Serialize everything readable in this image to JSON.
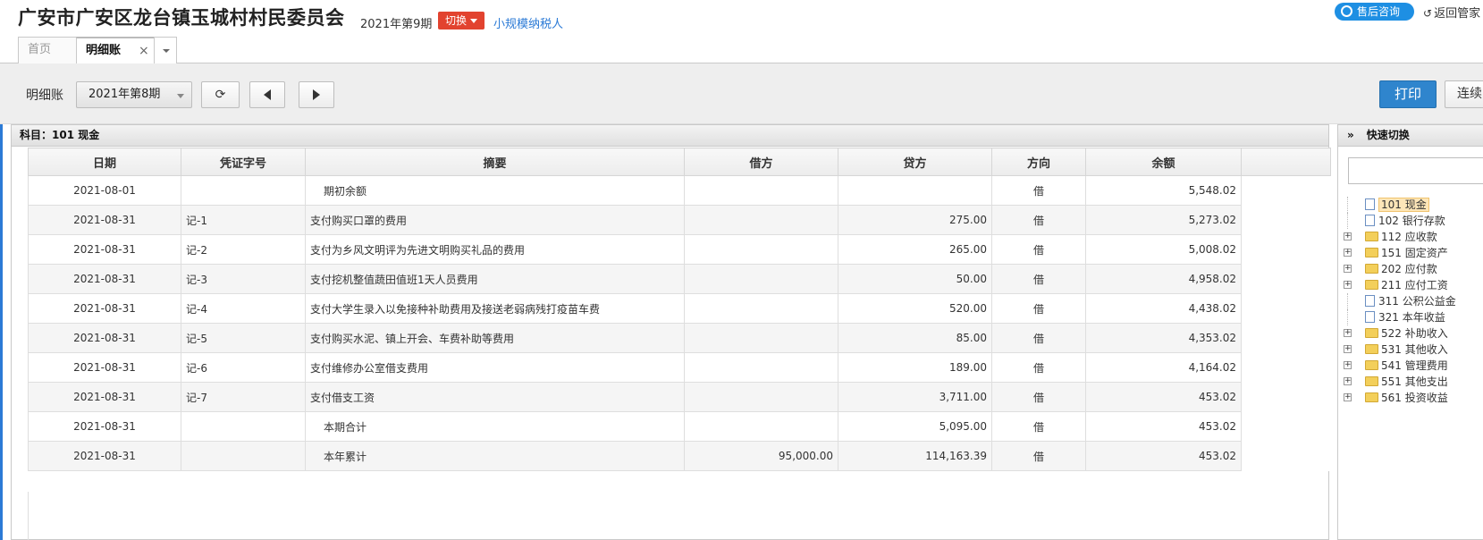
{
  "header": {
    "company": "广安市广安区龙台镇玉城村村民委员会",
    "period": "2021年第9期",
    "switch_label": "切换",
    "taxpayer_type": "小规模纳税人",
    "support_label": "售后咨询",
    "back_label": "返回管家"
  },
  "tabs": [
    {
      "label": "首页"
    },
    {
      "label": "明细账",
      "close": "×"
    }
  ],
  "toolbar": {
    "label": "明细账",
    "period_value": "2021年第8期",
    "print_label": "打印",
    "continuous_label": "连续"
  },
  "panel": {
    "title": "科目：101  现金"
  },
  "table": {
    "columns": [
      "日期",
      "凭证字号",
      "摘要",
      "借方",
      "贷方",
      "方向",
      "余额"
    ],
    "rows": [
      {
        "date": "2021-08-01",
        "voucher": "",
        "summary": "期初余额",
        "debit": "",
        "credit": "",
        "direction": "借",
        "balance": "5,548.02"
      },
      {
        "date": "2021-08-31",
        "voucher": "记-1",
        "summary": "支付购买口罩的费用",
        "debit": "",
        "credit": "275.00",
        "direction": "借",
        "balance": "5,273.02"
      },
      {
        "date": "2021-08-31",
        "voucher": "记-2",
        "summary": "支付为乡风文明评为先进文明购买礼品的费用",
        "debit": "",
        "credit": "265.00",
        "direction": "借",
        "balance": "5,008.02"
      },
      {
        "date": "2021-08-31",
        "voucher": "记-3",
        "summary": "支付挖机整值蔬田值班1天人员费用",
        "debit": "",
        "credit": "50.00",
        "direction": "借",
        "balance": "4,958.02"
      },
      {
        "date": "2021-08-31",
        "voucher": "记-4",
        "summary": "支付大学生录入以免接种补助费用及接送老弱病残打疫苗车费",
        "debit": "",
        "credit": "520.00",
        "direction": "借",
        "balance": "4,438.02"
      },
      {
        "date": "2021-08-31",
        "voucher": "记-5",
        "summary": "支付购买水泥、镇上开会、车费补助等费用",
        "debit": "",
        "credit": "85.00",
        "direction": "借",
        "balance": "4,353.02"
      },
      {
        "date": "2021-08-31",
        "voucher": "记-6",
        "summary": "支付维修办公室借支费用",
        "debit": "",
        "credit": "189.00",
        "direction": "借",
        "balance": "4,164.02"
      },
      {
        "date": "2021-08-31",
        "voucher": "记-7",
        "summary": "支付借支工资",
        "debit": "",
        "credit": "3,711.00",
        "direction": "借",
        "balance": "453.02"
      },
      {
        "date": "2021-08-31",
        "voucher": "",
        "summary": "本期合计",
        "debit": "",
        "credit": "5,095.00",
        "direction": "借",
        "balance": "453.02"
      },
      {
        "date": "2021-08-31",
        "voucher": "",
        "summary": "本年累计",
        "debit": "95,000.00",
        "credit": "114,163.39",
        "direction": "借",
        "balance": "453.02"
      }
    ]
  },
  "side": {
    "title": "快速切换",
    "tree": [
      {
        "label": "101 现金",
        "kind": "file",
        "selected": true
      },
      {
        "label": "102 银行存款",
        "kind": "file"
      },
      {
        "label": "112 应收款",
        "kind": "folder"
      },
      {
        "label": "151 固定资产",
        "kind": "folder"
      },
      {
        "label": "202 应付款",
        "kind": "folder"
      },
      {
        "label": "211 应付工资",
        "kind": "folder"
      },
      {
        "label": "311 公积公益金",
        "kind": "file"
      },
      {
        "label": "321 本年收益",
        "kind": "file"
      },
      {
        "label": "522 补助收入",
        "kind": "folder"
      },
      {
        "label": "531 其他收入",
        "kind": "folder"
      },
      {
        "label": "541 管理费用",
        "kind": "folder"
      },
      {
        "label": "551 其他支出",
        "kind": "folder"
      },
      {
        "label": "561 投资收益",
        "kind": "folder"
      }
    ]
  },
  "colors": {
    "accent": "#2f85cd",
    "switch": "#e2432f",
    "support": "#1e8fe3"
  }
}
